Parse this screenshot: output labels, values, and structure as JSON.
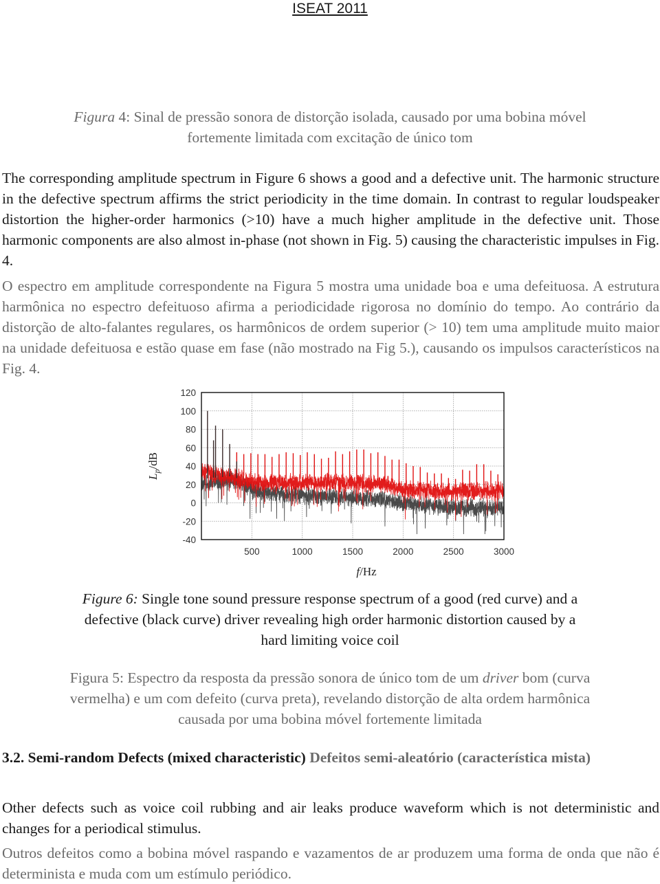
{
  "header": {
    "title": "ISEAT 2011"
  },
  "figure4_caption_pt": {
    "label": "Figura",
    "line1_rest": " 4: Sinal de pressão sonora de distorção isolada, causado por uma bobina móvel",
    "line2": "fortemente limitada com excitação de único tom"
  },
  "paragraph_en_1": "The corresponding amplitude spectrum in Figure 6 shows a good and a defective unit. The harmonic structure in the defective spectrum affirms the strict periodicity in the time domain. In contrast to regular loudspeaker distortion the higher-order harmonics (>10) have a much higher amplitude in the defective unit. Those harmonic components are also almost in-phase (not shown in Fig. 5) causing the characteristic impulses in Fig. 4.",
  "paragraph_pt_1": "O espectro em amplitude correspondente na Figura 5 mostra uma unidade boa e uma defeituosa. A estrutura harmônica no espectro defeituoso afirma a periodicidade rigorosa no domínio do tempo. Ao contrário da distorção de alto-falantes regulares, os harmônicos de ordem superior (> 10) tem uma amplitude muito maior na unidade defeituosa e estão quase em fase (não mostrado na Fig 5.), causando os impulsos característicos na Fig. 4.",
  "chart_data": {
    "type": "line",
    "title": "",
    "xlabel": "f/Hz",
    "ylabel": "Lp/dB",
    "xlim": [
      0,
      3000
    ],
    "ylim": [
      -40,
      120
    ],
    "xticks": [
      500,
      1000,
      1500,
      2000,
      2500,
      3000
    ],
    "yticks": [
      120,
      100,
      80,
      60,
      40,
      20,
      0,
      -20,
      -40
    ],
    "grid": true,
    "legend": "none",
    "series": [
      {
        "name": "good unit (red curve)",
        "color": "#e01010",
        "noise_floor": {
          "x": [
            0,
            300,
            600,
            1000,
            1500,
            1800,
            2000,
            2500,
            3000
          ],
          "y": [
            35,
            28,
            22,
            22,
            22,
            20,
            15,
            12,
            14
          ]
        },
        "harmonics": {
          "x": [
            350,
            420,
            490,
            560,
            630,
            700,
            770,
            840,
            910,
            980,
            1050,
            1120,
            1190,
            1260,
            1330,
            1400,
            1470,
            1540,
            1610,
            1680,
            1750,
            1820,
            1890,
            1960,
            2030,
            2100,
            2170,
            2240,
            2310,
            2380,
            2450,
            2520,
            2590,
            2660,
            2730,
            2800,
            2870,
            2940
          ],
          "y": [
            55,
            53,
            54,
            53,
            53,
            50,
            53,
            55,
            54,
            52,
            55,
            53,
            48,
            49,
            56,
            53,
            56,
            58,
            58,
            54,
            55,
            51,
            47,
            47,
            43,
            40,
            39,
            33,
            32,
            32,
            27,
            26,
            36,
            35,
            42,
            42,
            35,
            31
          ]
        }
      },
      {
        "name": "defective unit (black curve)",
        "color": "#2a2a2a",
        "noise_floor": {
          "x": [
            0,
            300,
            600,
            1000,
            1500,
            1800,
            2000,
            2500,
            3000
          ],
          "y": [
            22,
            25,
            12,
            8,
            6,
            3,
            0,
            -5,
            -5
          ]
        },
        "harmonics": {
          "x": [
            60,
            120,
            140,
            210,
            280,
            350
          ],
          "y": [
            100,
            68,
            84,
            80,
            64,
            45
          ]
        }
      }
    ]
  },
  "figure6_caption_en": {
    "label": "Figure 6:",
    "line1_rest": " Single tone sound pressure response spectrum of a good (red curve) and a",
    "line2": "defective (black curve) driver revealing high order harmonic distortion caused by a",
    "line3": "hard limiting voice coil"
  },
  "figure5_caption_pt": {
    "line1_a": "Figura 5: Espectro da resposta da pressão sonora de único tom de um ",
    "line1_italic": "driver",
    "line1_b": " bom (curva",
    "line2": "vermelha) e um com defeito (curva preta), revelando distorção de alta ordem harmônica",
    "line3": "causada por uma bobina móvel fortemente limitada"
  },
  "section": {
    "heading_en": "3.2. Semi-random Defects (mixed characteristic)",
    "heading_pt": " Defeitos semi-aleatório (característica mista)"
  },
  "paragraph_en_2": "Other defects such as voice coil rubbing and air leaks produce waveform which is not deterministic and changes for a periodical stimulus.",
  "paragraph_pt_2": "Outros defeitos como a bobina móvel raspando e vazamentos de ar produzem uma forma de onda que não é determinista e muda com um estímulo periódico."
}
